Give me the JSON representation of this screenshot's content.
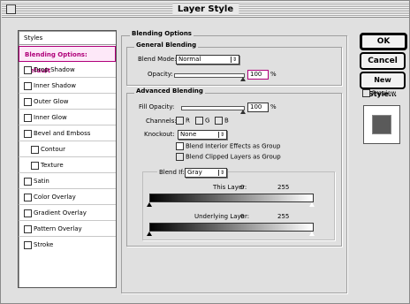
{
  "window": {
    "title": "Layer Style"
  },
  "styles_panel": {
    "title": "Styles",
    "items": [
      {
        "label": "Blending Options: Default",
        "selected": true,
        "checkbox": false
      },
      {
        "label": "Drop Shadow",
        "checkbox": true,
        "checked": false
      },
      {
        "label": "Inner Shadow",
        "checkbox": true,
        "checked": false
      },
      {
        "label": "Outer Glow",
        "checkbox": true,
        "checked": false
      },
      {
        "label": "Inner Glow",
        "checkbox": true,
        "checked": false
      },
      {
        "label": "Bevel and Emboss",
        "checkbox": true,
        "checked": false
      },
      {
        "label": "Contour",
        "checkbox": true,
        "checked": false
      },
      {
        "label": "Texture",
        "checkbox": true,
        "checked": false
      },
      {
        "label": "Satin",
        "checkbox": true,
        "checked": false
      },
      {
        "label": "Color Overlay",
        "checkbox": true,
        "checked": false
      },
      {
        "label": "Gradient Overlay",
        "checkbox": true,
        "checked": false
      },
      {
        "label": "Pattern Overlay",
        "checkbox": true,
        "checked": false
      },
      {
        "label": "Stroke",
        "checkbox": true,
        "checked": false
      }
    ]
  },
  "blending": {
    "section_title": "Blending Options",
    "general_title": "General Blending",
    "blend_mode_label": "Blend Mode:",
    "blend_mode_value": "Normal",
    "opacity_label": "Opacity:",
    "opacity_value": "100",
    "opacity_unit": "%",
    "advanced_title": "Advanced Blending",
    "fill_opacity_label": "Fill Opacity:",
    "fill_opacity_value": "100",
    "fill_opacity_unit": "%",
    "channels_label": "Channels:",
    "channel_r": "R",
    "channel_g": "G",
    "channel_b": "B",
    "knockout_label": "Knockout:",
    "knockout_value": "None",
    "option1": "Blend Interior Effects as Group",
    "option2": "Blend Clipped Layers as Group",
    "blend_if_label": "Blend If:",
    "blend_if_value": "Gray",
    "this_layer_label": "This Layer:",
    "this_layer_min": "0",
    "this_layer_max": "255",
    "underlying_label": "Underlying Layer:",
    "underlying_min": "0",
    "underlying_max": "255"
  },
  "buttons": {
    "ok": "OK",
    "cancel": "Cancel",
    "new_style": "New Style...",
    "preview": "Preview"
  }
}
